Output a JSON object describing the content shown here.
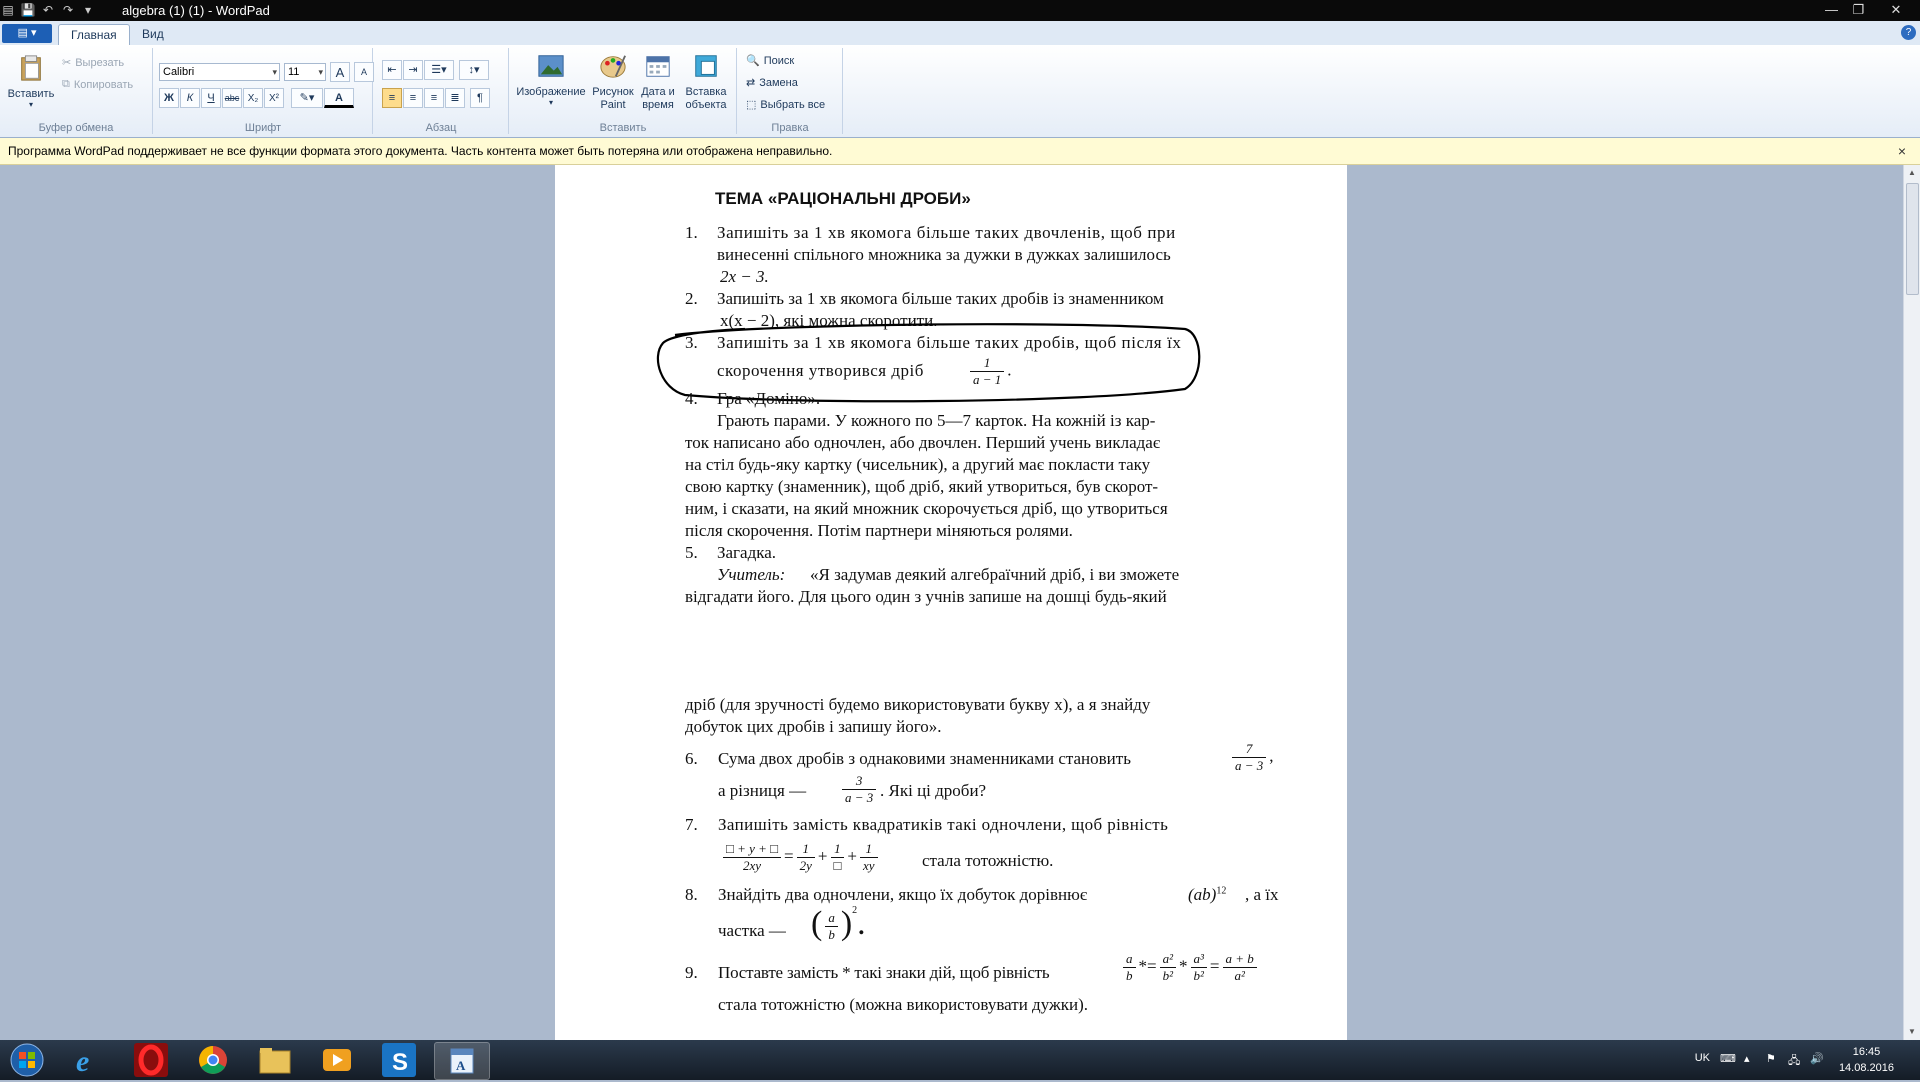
{
  "window": {
    "title": "algebra (1) (1) - WordPad"
  },
  "ribbon": {
    "file_button": "▤ ▾",
    "tabs": [
      "Главная",
      "Вид"
    ],
    "clipboard": {
      "paste": "Вставить",
      "cut": "Вырезать",
      "copy": "Копировать",
      "label": "Буфер обмена"
    },
    "font": {
      "family": "Calibri",
      "size": "11",
      "label": "Шрифт",
      "bold": "Ж",
      "italic": "К",
      "underline": "Ч",
      "strike": "abc",
      "sub": "X₂",
      "sup": "X²",
      "grow": "A",
      "shrink": "A",
      "color": "A"
    },
    "paragraph": {
      "label": "Абзац"
    },
    "insert": {
      "picture": "Изображение",
      "paint": "Рисунок Paint",
      "datetime": "Дата и время",
      "object": "Вставка объекта",
      "label": "Вставить"
    },
    "editing": {
      "find": "Поиск",
      "replace": "Замена",
      "select_all": "Выбрать все",
      "label": "Правка"
    }
  },
  "infobar": {
    "text": "Программа WordPad поддерживает не все функции формата этого документа. Часть контента может быть потеряна или отображена неправильно.",
    "close": "×"
  },
  "document": {
    "heading": "ТЕМА «РАЦІОНАЛЬНІ ДРОБИ»",
    "items": [
      {
        "num": "1.",
        "lines": [
          "Запишіть за 1 хв якомога більше таких двочленів, щоб при",
          "винесенні спільного множника за дужки в дужках залишилось",
          "2x − 3."
        ]
      },
      {
        "num": "2.",
        "lines": [
          "Запишіть за 1 хв якомога більше таких дробів із знаменником",
          "x(x − 2), які можна скоротити."
        ]
      },
      {
        "num": "3.",
        "lines": [
          "Запишіть за 1 хв якомога більше таких дробів, щоб після їх",
          "скорочення утворився дріб"
        ],
        "frac": {
          "n": "1",
          "d": "a − 1"
        }
      },
      {
        "num": "4.",
        "lines": [
          "Гра «Доміно».",
          "Грають парами. У кожного по 5—7 карток. На кожній із кар-",
          "ток написано або одночлен, або двочлен. Перший учень викладає",
          "на стіл будь-яку картку (чисельник), а другий має покласти таку",
          "свою картку (знаменник), щоб дріб, який утвориться, був скорот-",
          "ним, і сказати, на який множник скорочується дріб, що утвориться",
          "після скорочення. Потім партнери міняються ролями."
        ]
      },
      {
        "num": "5.",
        "lines": [
          "Загадка.",
          "Учитель:",
          "«Я задумав деякий алгебраїчний дріб, і ви зможете",
          "відгадати його. Для цього один з учнів запише на дошці будь-який",
          "дріб (для зручності будемо використовувати букву x), а я знайду",
          "добуток цих дробів і запишу його»."
        ]
      },
      {
        "num": "6.",
        "lines": [
          "Сума двох дробів з однаковими знаменниками становить",
          "а різниця —",
          ". Які ці дроби?"
        ],
        "frac1": {
          "n": "7",
          "d": "a − 3"
        },
        "frac2": {
          "n": "3",
          "d": "a − 3"
        }
      },
      {
        "num": "7.",
        "lines": [
          "Запишіть замість квадратиків такі одночлени, щоб рівність",
          "стала тотожністю."
        ],
        "formula": {
          "n": "□ + y + □",
          "d": "2xy",
          "eq": "=",
          "f1n": "1",
          "f1d": "2y",
          "f2n": "1",
          "f2d": "□",
          "f3n": "1",
          "f3d": "xy",
          "plus": "+"
        }
      },
      {
        "num": "8.",
        "lines": [
          "Знайдіть два одночлени, якщо їх добуток дорівнює",
          ", а їх",
          "частка —"
        ],
        "power": "(ab)",
        "exp": "12",
        "paren": {
          "n": "a",
          "d": "b",
          "exp": "2"
        }
      },
      {
        "num": "9.",
        "lines": [
          "Поставте замість * такі знаки дій, щоб рівність",
          "стала тотожністю (можна використовувати дужки)."
        ],
        "formula": {
          "a": "a",
          "b": "b",
          "a2": "a²",
          "b2": "b²",
          "a3": "a³",
          "b2b": "b²",
          "sum": "a + b",
          "a2d": "a²",
          "star": "*",
          "eq": "="
        }
      }
    ]
  },
  "taskbar": {
    "lang": "UK",
    "time": "16:45",
    "date": "14.08.2016"
  }
}
